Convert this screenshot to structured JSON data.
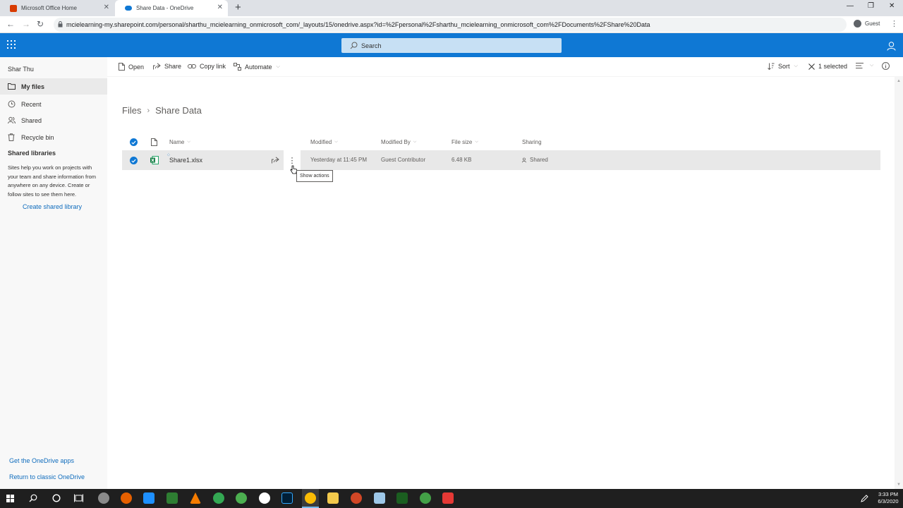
{
  "browser": {
    "tabs": [
      {
        "title": "Microsoft Office Home",
        "icon": "office-icon",
        "active": false
      },
      {
        "title": "Share Data - OneDrive",
        "icon": "onedrive-icon",
        "active": true
      }
    ],
    "url": "mcielearning-my.sharepoint.com/personal/sharthu_mcielearning_onmicrosoft_com/_layouts/15/onedrive.aspx?id=%2Fpersonal%2Fsharthu_mcielearning_onmicrosoft_com%2FDocuments%2FShare%20Data",
    "profile": "Guest"
  },
  "suitebar": {
    "search_placeholder": "Search",
    "color": "#0f78d4"
  },
  "nav": {
    "user": "Shar Thu",
    "items": [
      {
        "label": "My files",
        "icon": "folder-icon",
        "selected": true
      },
      {
        "label": "Recent",
        "icon": "clock-icon",
        "selected": false
      },
      {
        "label": "Shared",
        "icon": "people-icon",
        "selected": false
      },
      {
        "label": "Recycle bin",
        "icon": "trash-icon",
        "selected": false
      }
    ],
    "shared_libraries_heading": "Shared libraries",
    "shared_libraries_desc": "Sites help you work on projects with your team and share information from anywhere on any device. Create or follow sites to see them here.",
    "create_library": "Create shared library",
    "get_apps": "Get the OneDrive apps",
    "classic": "Return to classic OneDrive"
  },
  "commands": {
    "open": "Open",
    "share": "Share",
    "copy_link": "Copy link",
    "automate": "Automate",
    "sort": "Sort",
    "selected": "1 selected"
  },
  "breadcrumb": {
    "root": "Files",
    "current": "Share Data"
  },
  "columns": {
    "name": "Name",
    "modified": "Modified",
    "modified_by": "Modified By",
    "file_size": "File size",
    "sharing": "Sharing"
  },
  "files": [
    {
      "name": "Share1.xlsx",
      "modified": "Yesterday at 11:45 PM",
      "modified_by": "Guest Contributor",
      "size": "6.48 KB",
      "sharing": "Shared",
      "selected": true,
      "icon": "excel-icon"
    }
  ],
  "tooltip": "Show actions",
  "taskbar": {
    "time": "3:33 PM",
    "date": "6/3/2020"
  }
}
